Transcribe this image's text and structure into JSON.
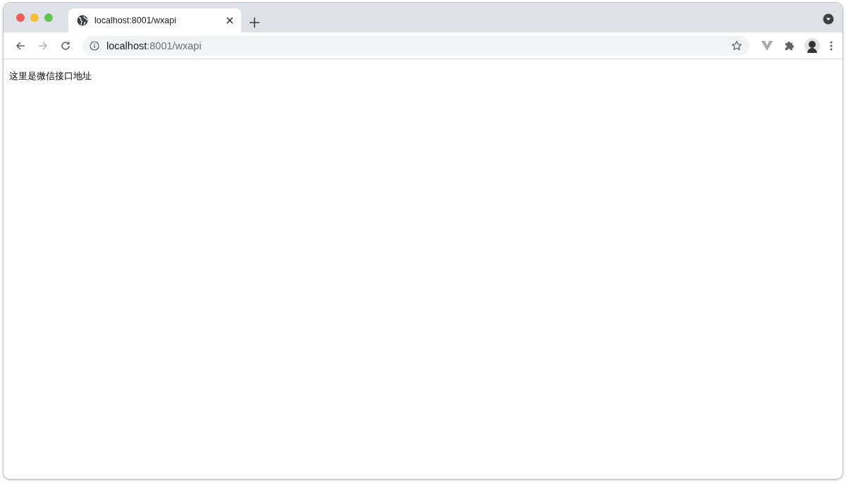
{
  "tabs": [
    {
      "title": "localhost:8001/wxapi",
      "selected": true
    }
  ],
  "nav_buttons": [
    {
      "kind": "back",
      "disabled": false
    },
    {
      "kind": "forward",
      "disabled": true
    },
    {
      "kind": "reload",
      "disabled": false
    }
  ],
  "address_bar": {
    "host": "localhost",
    "path": ":8001/wxapi"
  },
  "page": {
    "text": "这里是微信接口地址"
  }
}
